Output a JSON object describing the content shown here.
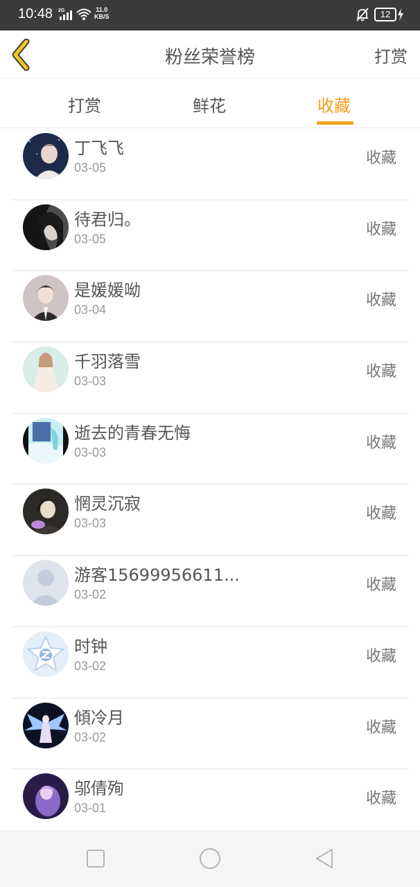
{
  "status_bar": {
    "time": "10:48",
    "network": "2G",
    "speed_value": "11.0",
    "speed_unit": "KB/S",
    "battery": "12"
  },
  "header": {
    "title": "粉丝荣誉榜",
    "action": "打赏"
  },
  "tabs": [
    {
      "label": "打赏",
      "active": false
    },
    {
      "label": "鲜花",
      "active": false
    },
    {
      "label": "收藏",
      "active": true
    }
  ],
  "accent_color": "#f0a020",
  "list": [
    {
      "name": "丁飞飞",
      "date": "03-05",
      "action": "收藏"
    },
    {
      "name": "待君归。",
      "date": "03-05",
      "action": "收藏"
    },
    {
      "name": "是媛媛呦",
      "date": "03-04",
      "action": "收藏"
    },
    {
      "name": "千羽落雪",
      "date": "03-03",
      "action": "收藏"
    },
    {
      "name": "逝去的青春无悔",
      "date": "03-03",
      "action": "收藏"
    },
    {
      "name": "惘灵沉寂",
      "date": "03-03",
      "action": "收藏"
    },
    {
      "name": "游客15699956611...",
      "date": "03-02",
      "action": "收藏"
    },
    {
      "name": "时钟",
      "date": "03-02",
      "action": "收藏"
    },
    {
      "name": "傾冷月",
      "date": "03-02",
      "action": "收藏"
    },
    {
      "name": "邬倩殉",
      "date": "03-01",
      "action": "收藏"
    }
  ]
}
